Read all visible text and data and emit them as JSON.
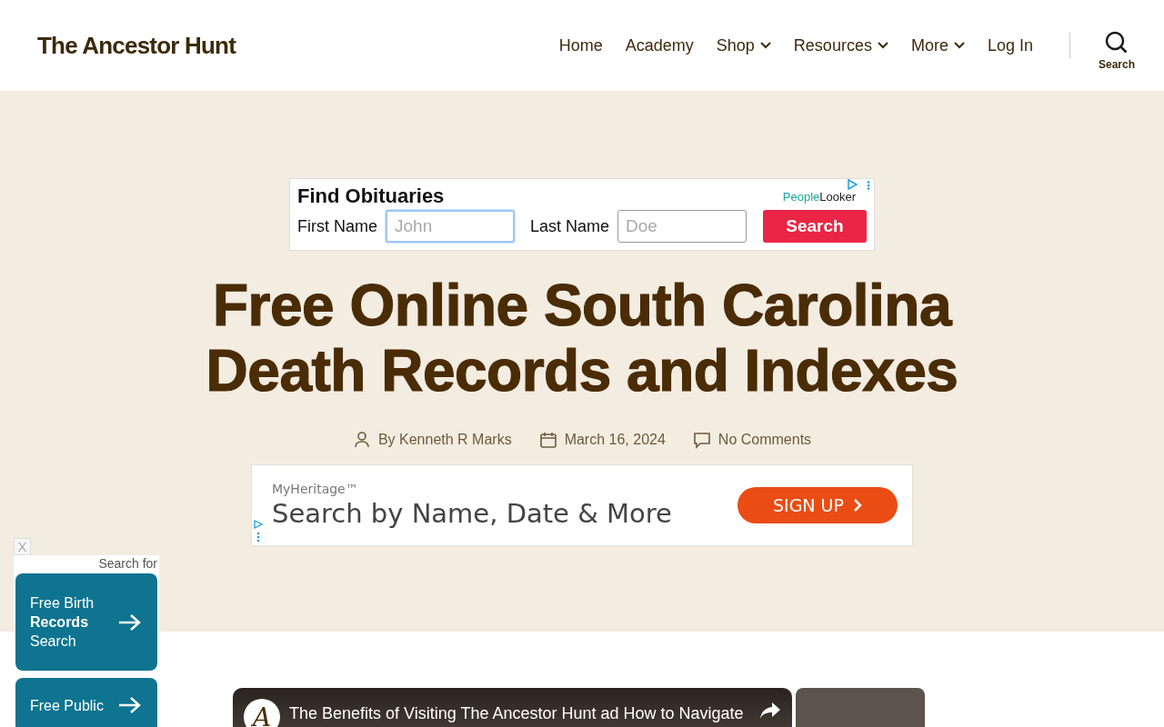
{
  "site_title": "The Ancestor Hunt",
  "nav": [
    {
      "label": "Home",
      "has_menu": false
    },
    {
      "label": "Academy",
      "has_menu": false
    },
    {
      "label": "Shop",
      "has_menu": true
    },
    {
      "label": "Resources",
      "has_menu": true
    },
    {
      "label": "More",
      "has_menu": true
    },
    {
      "label": "Log In",
      "has_menu": false
    }
  ],
  "search_toggle": {
    "label": "Search"
  },
  "obituary_ad": {
    "title": "Find Obituaries",
    "brand_first": "People",
    "brand_second": "Looker",
    "fields": [
      {
        "label": "First Name",
        "placeholder": "John",
        "focused": true
      },
      {
        "label": "Last Name",
        "placeholder": "Doe",
        "focused": false
      }
    ],
    "button": "Search"
  },
  "article": {
    "title": "Free Online South Carolina Death Records and Indexes",
    "author": "By Kenneth R Marks",
    "date": "March 16, 2024",
    "comments": "No Comments"
  },
  "heritage_ad": {
    "brand": "MyHeritage™",
    "headline": "Search by Name, Date & More",
    "button": "SIGN UP"
  },
  "side_widget": {
    "close": "X",
    "heading": "Search for",
    "cards": [
      {
        "lines": [
          "Free Birth",
          "**Records**",
          "Search"
        ]
      },
      {
        "lines": [
          "Free Public"
        ]
      }
    ]
  },
  "video": {
    "channel_initial": "A",
    "title": "The Benefits of Visiting The Ancestor Hunt ad How to Navigate"
  }
}
